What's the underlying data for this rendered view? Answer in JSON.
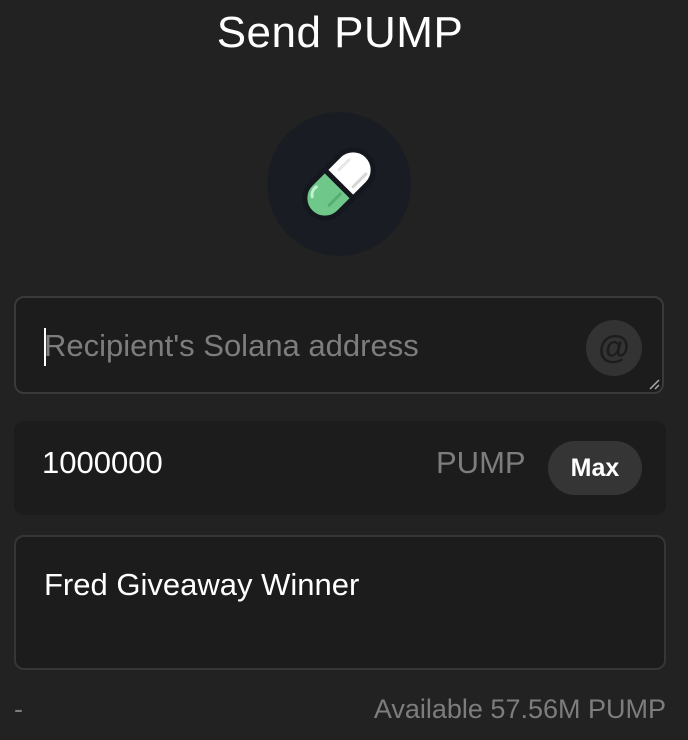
{
  "header": {
    "title": "Send PUMP"
  },
  "token": {
    "icon": "pill-icon",
    "colors": {
      "circle_bg": "#1a1c24",
      "pill_top": "#ffffff",
      "pill_bottom": "#6fc88a",
      "outline": "#14171d"
    }
  },
  "recipient": {
    "placeholder": "Recipient's Solana address",
    "value": "",
    "at_label": "@"
  },
  "amount": {
    "value": "1000000",
    "unit": "PUMP",
    "max_label": "Max"
  },
  "memo": {
    "value": "Fred Giveaway Winner"
  },
  "footer": {
    "left_text": "-",
    "available_text": "Available 57.56M PUMP"
  },
  "colors": {
    "background": "#222222",
    "field_bg": "#1c1c1c",
    "muted_text": "#7d7d7d"
  }
}
